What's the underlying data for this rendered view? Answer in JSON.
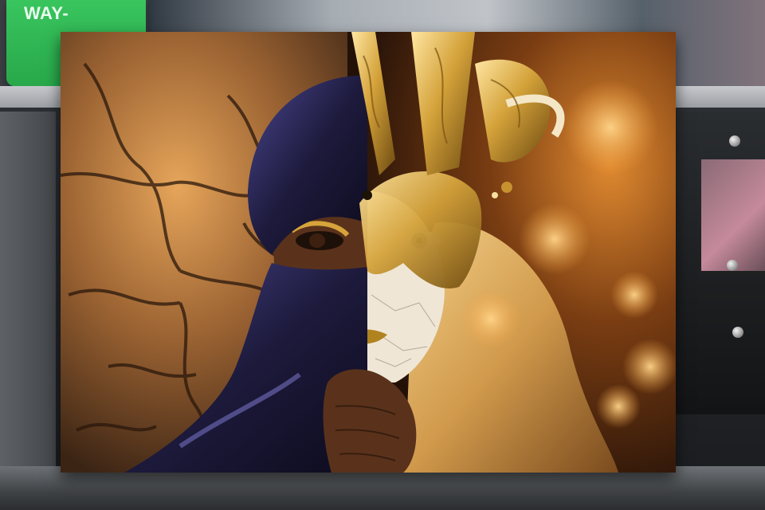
{
  "sign": {
    "text": "WAY-"
  },
  "colors": {
    "desert": "#9a6a35",
    "gold": "#d4a23a",
    "silk": "#2a2650",
    "bokeh": "#f0a040"
  },
  "icons": [
    "screw-icon"
  ]
}
